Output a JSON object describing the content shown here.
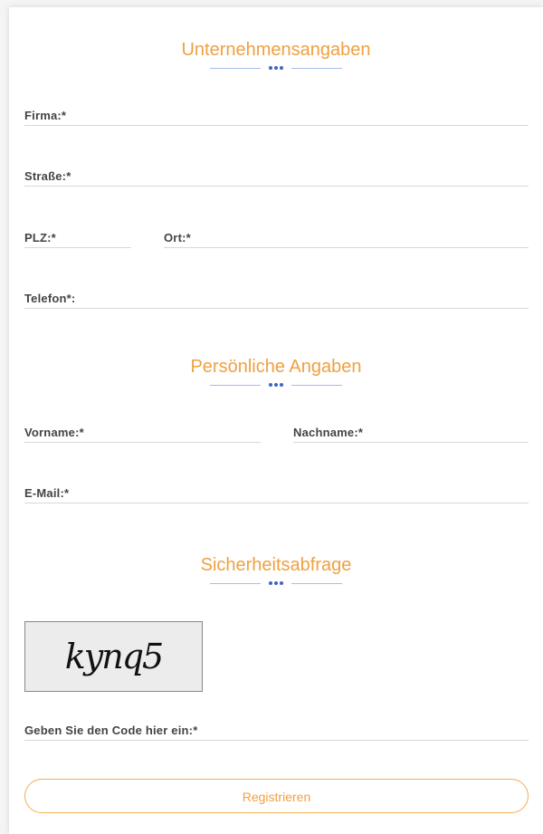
{
  "sections": {
    "company": {
      "title": "Unternehmensangaben"
    },
    "personal": {
      "title": "Persönliche Angaben"
    },
    "security": {
      "title": "Sicherheitsabfrage"
    }
  },
  "fields": {
    "firma": {
      "label": "Firma:*",
      "value": ""
    },
    "strasse": {
      "label": "Straße:*",
      "value": ""
    },
    "plz": {
      "label": "PLZ:*",
      "value": ""
    },
    "ort": {
      "label": "Ort:*",
      "value": ""
    },
    "telefon": {
      "label": "Telefon*:",
      "value": ""
    },
    "vorname": {
      "label": "Vorname:*",
      "value": ""
    },
    "nachname": {
      "label": "Nachname:*",
      "value": ""
    },
    "email": {
      "label": "E-Mail:*",
      "value": ""
    },
    "code": {
      "label": "Geben Sie den Code hier ein:*",
      "value": ""
    }
  },
  "captcha": {
    "text": "kynq5"
  },
  "submit": {
    "label": "Registrieren"
  },
  "colors": {
    "accent": "#f0a040",
    "divider_dot": "#3b63c8",
    "divider_line": "#a9bde8"
  }
}
